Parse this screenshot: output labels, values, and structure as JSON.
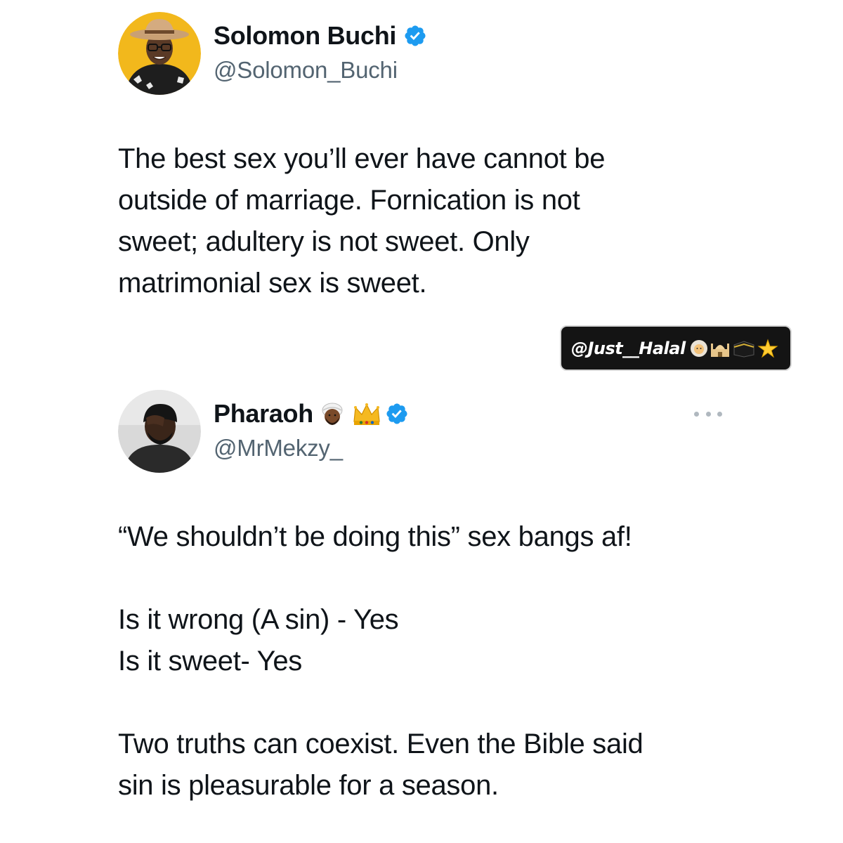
{
  "tweets": [
    {
      "display_name": "Solomon Buchi",
      "handle": "@Solomon_Buchi",
      "verified": true,
      "text_lines": [
        "The best sex you’ll ever have cannot be",
        "outside of marriage.  Fornication is not",
        "sweet; adultery is not sweet. Only",
        "matrimonial sex is sweet."
      ]
    },
    {
      "display_name": "Pharaoh",
      "handle": "@MrMekzy_",
      "verified": true,
      "name_emojis": [
        "man-with-turban-emoji",
        "crown-emoji"
      ],
      "text_lines": [
        "“We shouldn’t be doing this” sex bangs af!",
        "",
        "Is it wrong (A sin) - Yes",
        "Is it sweet- Yes",
        "",
        "Two truths can coexist. Even the Bible said",
        "sin is pleasurable for a season."
      ]
    }
  ],
  "watermark": {
    "text": "@Just__Halal",
    "emojis": [
      "woman-with-headscarf-emoji",
      "mosque-emoji",
      "kaaba-emoji",
      "sparkle-star-emoji"
    ]
  },
  "colors": {
    "text": "#0f1419",
    "handle": "#536471",
    "verified": "#1d9bf0",
    "watermark_bg": "#141414"
  }
}
